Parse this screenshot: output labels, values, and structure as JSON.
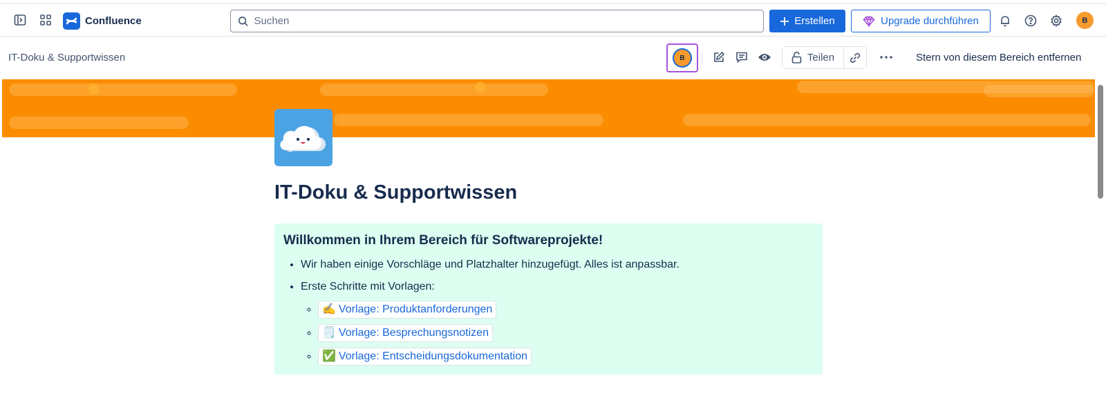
{
  "topnav": {
    "app_name": "Confluence",
    "search_placeholder": "Suchen",
    "create_label": "Erstellen",
    "upgrade_label": "Upgrade durchführen",
    "user_initial": "B"
  },
  "toolbar": {
    "space_name": "IT-Doku & Supportwissen",
    "avatar_initial": "B",
    "share_label": "Teilen",
    "unstar_label": "Stern von diesem Bereich entfernen"
  },
  "page": {
    "title": "IT-Doku & Supportwissen",
    "panel": {
      "heading": "Willkommen in Ihrem Bereich für Softwareprojekte!",
      "bullet_1": "Wir haben einige Vorschläge und Platzhalter hinzugefügt. Alles ist anpassbar.",
      "bullet_2": "Erste Schritte mit Vorlagen:",
      "links": [
        {
          "emoji": "✍️",
          "label": "Vorlage: Produktanforderungen"
        },
        {
          "emoji": "🗒️",
          "label": "Vorlage: Besprechungsnotizen"
        },
        {
          "emoji": "✅",
          "label": "Vorlage: Entscheidungsdokumentation"
        }
      ]
    }
  },
  "colors": {
    "brand_blue": "#1868db",
    "banner_orange": "#fb8c00",
    "panel_green": "#dcfff1",
    "avatar_orange": "#f79a2c",
    "focus_purple": "#a652d9"
  },
  "icons": [
    "sidebar-toggle-icon",
    "app-switcher-icon",
    "confluence-logo-icon",
    "search-icon",
    "plus-icon",
    "diamond-icon",
    "bell-icon",
    "help-icon",
    "gear-icon",
    "edit-icon",
    "comment-icon",
    "eye-icon",
    "unlock-icon",
    "link-icon",
    "more-icon",
    "cloud-icon"
  ]
}
